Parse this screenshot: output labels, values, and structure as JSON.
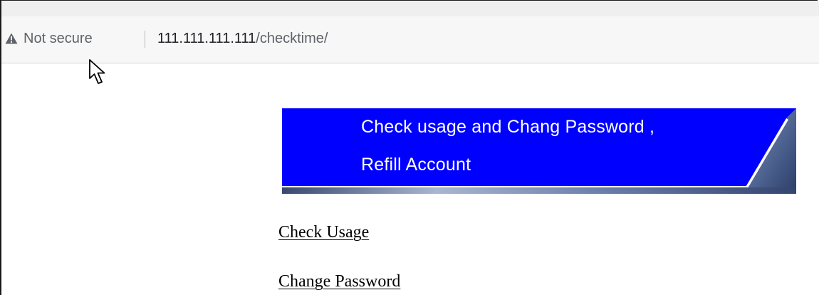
{
  "address_bar": {
    "security_label": "Not secure",
    "url_host": "111.111.111.111",
    "url_path": "/checktime/"
  },
  "banner": {
    "line1": "Check usage and Chang Password ,",
    "line2": "Refill Account",
    "background_color": "#0000ff"
  },
  "links": {
    "check_usage": "Check Usage",
    "change_password": "Change Password"
  },
  "icons": {
    "security": "warning-triangle-icon",
    "pointer": "mouse-cursor-icon"
  }
}
